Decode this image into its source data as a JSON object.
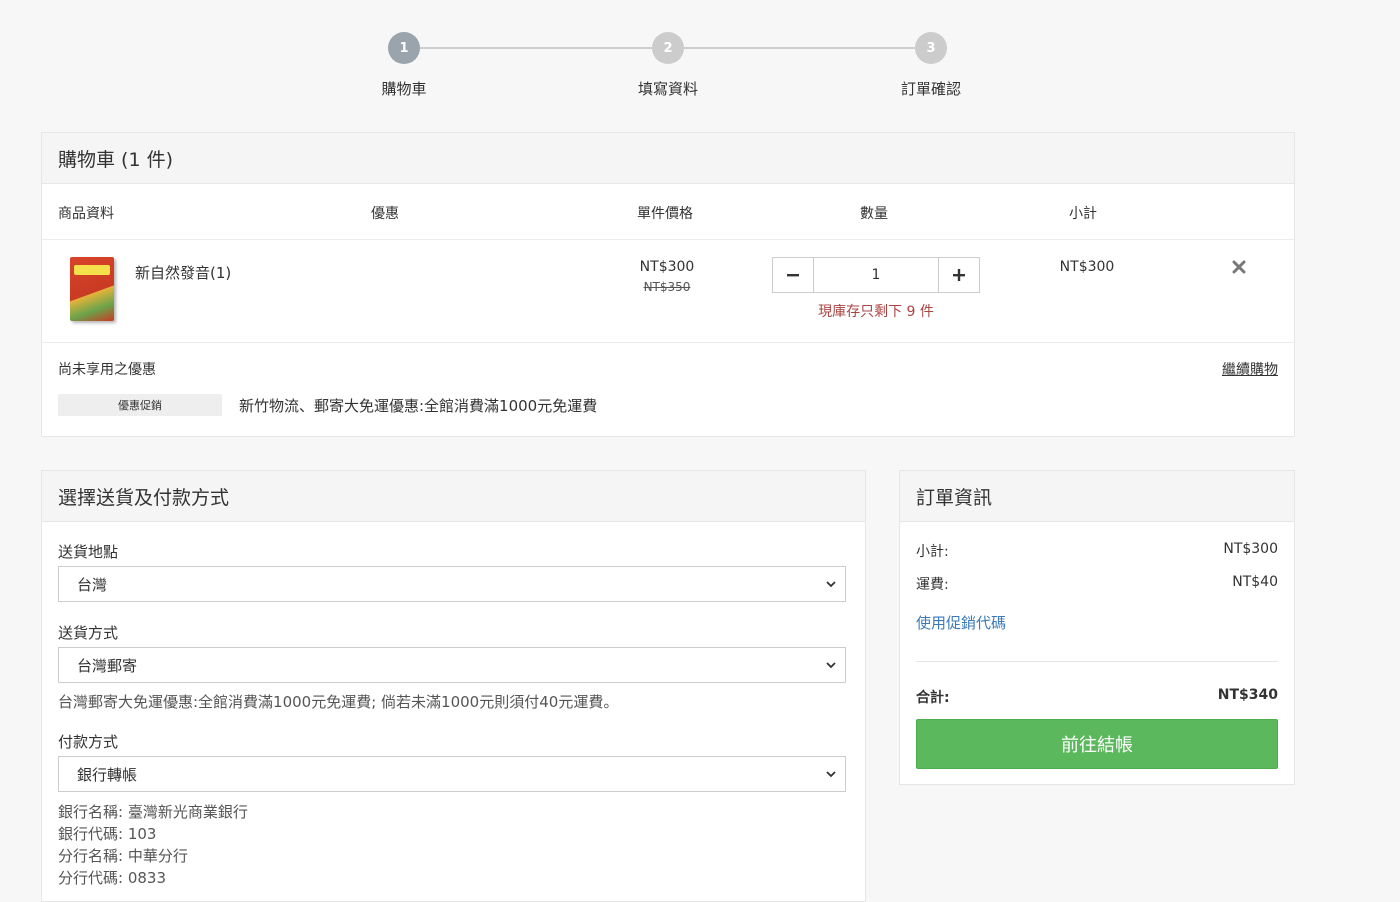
{
  "steps": [
    {
      "num": "1",
      "label": "購物車"
    },
    {
      "num": "2",
      "label": "填寫資料"
    },
    {
      "num": "3",
      "label": "訂單確認"
    }
  ],
  "cart": {
    "title": "購物車 (1 件)",
    "columns": {
      "product": "商品資料",
      "discount": "優惠",
      "unit_price": "單件價格",
      "quantity": "數量",
      "subtotal": "小計"
    },
    "item": {
      "name": "新自然發音(1)",
      "price": "NT$300",
      "original_price": "NT$350",
      "quantity": "1",
      "stock_note": "現庫存只剩下 9 件",
      "subtotal": "NT$300",
      "remove_icon": "close-icon"
    },
    "promo_title": "尚未享用之優惠",
    "continue_shopping": "繼續購物",
    "promo_tag": "優惠促銷",
    "promo_text": "新竹物流、郵寄大免運優惠:全館消費滿1000元免運費"
  },
  "shipping": {
    "title": "選擇送貨及付款方式",
    "location_label": "送貨地點",
    "location_value": "台灣",
    "method_label": "送貨方式",
    "method_value": "台灣郵寄",
    "method_hint": "台灣郵寄大免運優惠:全館消費滿1000元免運費; 倘若未滿1000元則須付40元運費。",
    "payment_label": "付款方式",
    "payment_value": "銀行轉帳",
    "bank_info": [
      "銀行名稱: 臺灣新光商業銀行",
      "銀行代碼: 103",
      "分行名稱: 中華分行",
      "分行代碼: 0833"
    ]
  },
  "order": {
    "title": "訂單資訊",
    "subtotal_label": "小計:",
    "subtotal_value": "NT$300",
    "shipping_label": "運費:",
    "shipping_value": "NT$40",
    "promo_code_link": "使用促銷代碼",
    "total_label": "合計:",
    "total_value": "NT$340",
    "checkout_button": "前往結帳"
  },
  "colors": {
    "accent_green": "#5cb85c",
    "link_blue": "#3a7ab8",
    "warning_red": "#a94442",
    "step_active": "#9aa4ad"
  }
}
